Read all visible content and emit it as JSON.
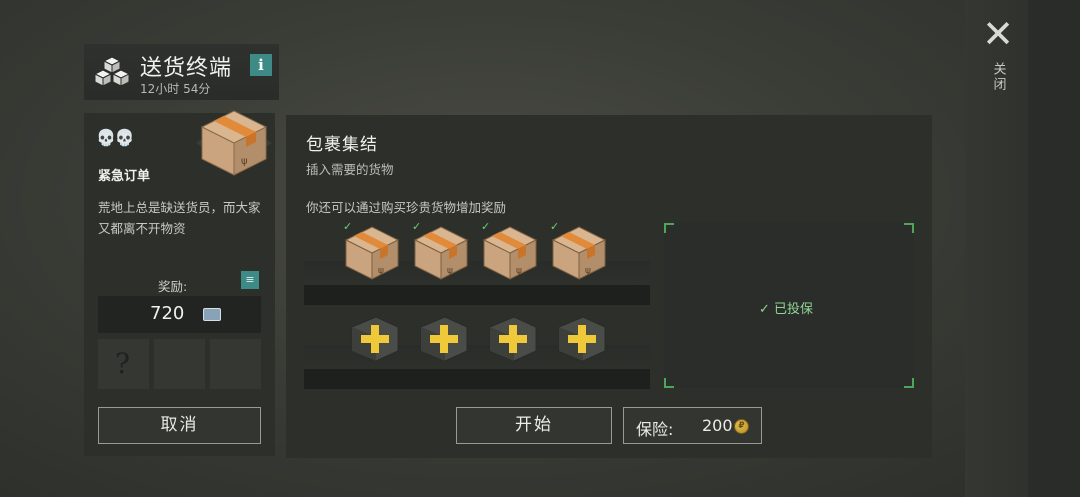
{
  "header": {
    "title": "送货终端",
    "subtitle": "12小时 54分",
    "info_label": "i"
  },
  "close": {
    "label": "关闭",
    "glyph": "✕"
  },
  "order": {
    "difficulty_icons": "💀💀",
    "title": "紧急订单",
    "description": "荒地上总是缺送货员，而大家又都离不开物资",
    "reward_label": "奖励:",
    "reward_value": "720",
    "unknown_slot": "?",
    "cancel_label": "取消"
  },
  "assembly": {
    "title": "包裹集结",
    "subtitle": "插入需要的货物",
    "bonus_text": "你还可以通过购买珍贵货物增加奖励",
    "checkmark": "✓",
    "packages_filled": 4,
    "add_slots": 4,
    "insured_label": "✓ 已投保",
    "start_label": "开始",
    "insurance_label": "保险:",
    "insurance_value": "200"
  },
  "colors": {
    "accent_teal": "#3d8a86",
    "check_green": "#6fcf74",
    "plus_yellow": "#f0c93a",
    "box_cardboard": "#c9a47e",
    "box_tape": "#e08a3a"
  }
}
